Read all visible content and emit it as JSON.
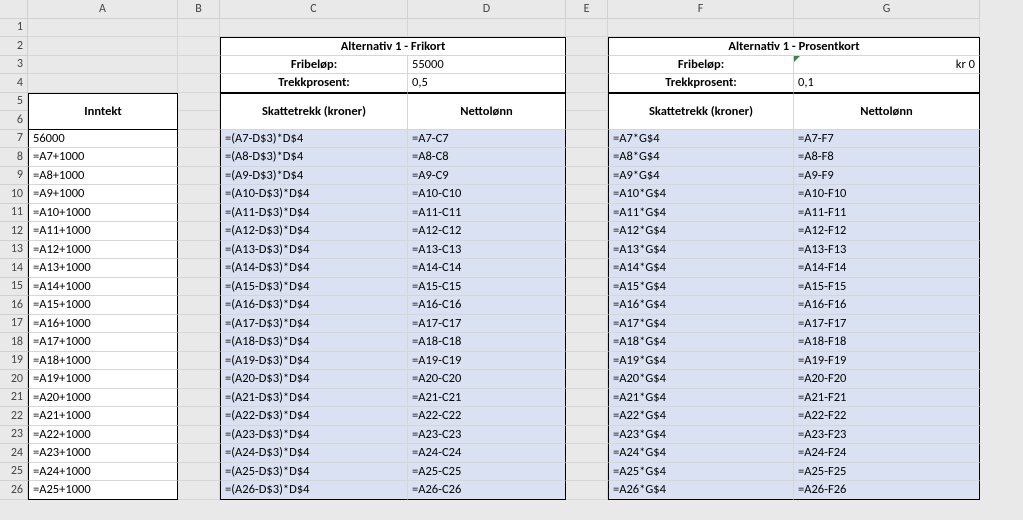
{
  "columns": [
    "A",
    "B",
    "C",
    "D",
    "E",
    "F",
    "G"
  ],
  "row_count": 26,
  "left": {
    "header": "Inntekt",
    "rows": [
      "56000",
      "=A7+1000",
      "=A8+1000",
      "=A9+1000",
      "=A10+1000",
      "=A11+1000",
      "=A12+1000",
      "=A13+1000",
      "=A14+1000",
      "=A15+1000",
      "=A16+1000",
      "=A17+1000",
      "=A18+1000",
      "=A19+1000",
      "=A20+1000",
      "=A21+1000",
      "=A22+1000",
      "=A23+1000",
      "=A24+1000",
      "=A25+1000"
    ]
  },
  "block1": {
    "title": "Alternativ 1 - Frikort",
    "row1_label": "Fribeløp:",
    "row1_value": "55000",
    "row2_label": "Trekkprosent:",
    "row2_value": "0,5",
    "col1_header": "Skattetrekk (kroner)",
    "col2_header": "Nettolønn",
    "col1_rows": [
      "=(A7-D$3)*D$4",
      "=(A8-D$3)*D$4",
      "=(A9-D$3)*D$4",
      "=(A10-D$3)*D$4",
      "=(A11-D$3)*D$4",
      "=(A12-D$3)*D$4",
      "=(A13-D$3)*D$4",
      "=(A14-D$3)*D$4",
      "=(A15-D$3)*D$4",
      "=(A16-D$3)*D$4",
      "=(A17-D$3)*D$4",
      "=(A18-D$3)*D$4",
      "=(A19-D$3)*D$4",
      "=(A20-D$3)*D$4",
      "=(A21-D$3)*D$4",
      "=(A22-D$3)*D$4",
      "=(A23-D$3)*D$4",
      "=(A24-D$3)*D$4",
      "=(A25-D$3)*D$4",
      "=(A26-D$3)*D$4"
    ],
    "col2_rows": [
      "=A7-C7",
      "=A8-C8",
      "=A9-C9",
      "=A10-C10",
      "=A11-C11",
      "=A12-C12",
      "=A13-C13",
      "=A14-C14",
      "=A15-C15",
      "=A16-C16",
      "=A17-C17",
      "=A18-C18",
      "=A19-C19",
      "=A20-C20",
      "=A21-C21",
      "=A22-C22",
      "=A23-C23",
      "=A24-C24",
      "=A25-C25",
      "=A26-C26"
    ]
  },
  "block2": {
    "title": "Alternativ 1 - Prosentkort",
    "row1_label": "Fribeløp:",
    "row1_value": "kr 0",
    "row2_label": "Trekkprosent:",
    "row2_value": "0,1",
    "col1_header": "Skattetrekk (kroner)",
    "col2_header": "Nettolønn",
    "col1_rows": [
      "=A7*G$4",
      "=A8*G$4",
      "=A9*G$4",
      "=A10*G$4",
      "=A11*G$4",
      "=A12*G$4",
      "=A13*G$4",
      "=A14*G$4",
      "=A15*G$4",
      "=A16*G$4",
      "=A17*G$4",
      "=A18*G$4",
      "=A19*G$4",
      "=A20*G$4",
      "=A21*G$4",
      "=A22*G$4",
      "=A23*G$4",
      "=A24*G$4",
      "=A25*G$4",
      "=A26*G$4"
    ],
    "col2_rows": [
      "=A7-F7",
      "=A8-F8",
      "=A9-F9",
      "=A10-F10",
      "=A11-F11",
      "=A12-F12",
      "=A13-F13",
      "=A14-F14",
      "=A15-F15",
      "=A16-F16",
      "=A17-F17",
      "=A18-F18",
      "=A19-F19",
      "=A20-F20",
      "=A21-F21",
      "=A22-F22",
      "=A23-F23",
      "=A24-F24",
      "=A25-F25",
      "=A26-F26"
    ]
  }
}
